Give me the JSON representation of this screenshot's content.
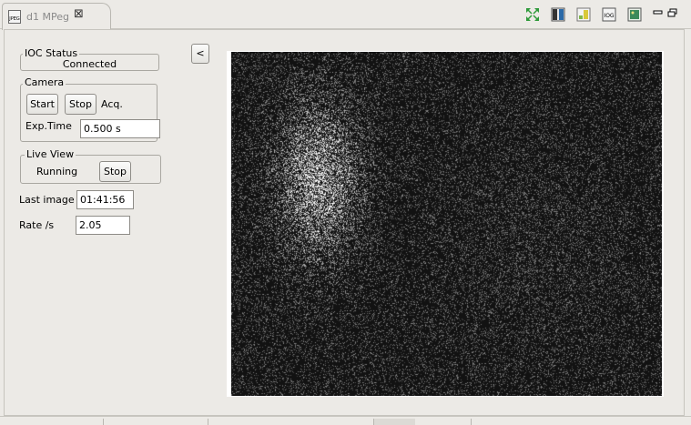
{
  "tab": {
    "label": "d1 MPeg",
    "icon": "jpeg-file-icon",
    "icon_text": "JPEG"
  },
  "toolbar": {
    "icons": [
      "fit-zoom-icon",
      "colormap-icon",
      "intensity-scale-icon",
      "log-scale-icon",
      "image-icon"
    ],
    "log_icon_text": "IOG"
  },
  "ioc_status": {
    "label": "IOC Status",
    "value": "Connected"
  },
  "camera": {
    "label": "Camera",
    "start_label": "Start",
    "stop_label": "Stop",
    "acq_label": "Acq.",
    "exp_time_label": "Exp.Time",
    "exp_time_value": "0.500 s"
  },
  "live_view": {
    "label": "Live View",
    "status": "Running",
    "stop_label": "Stop"
  },
  "last_image": {
    "label": "Last image",
    "value": "01:41:56"
  },
  "rate": {
    "label": "Rate /s",
    "value": "2.05"
  },
  "collapse_button": {
    "label": "<"
  },
  "colors": {
    "background": "#eceae6",
    "image_bg": "#151515",
    "tab_label": "#8a8a8a"
  }
}
